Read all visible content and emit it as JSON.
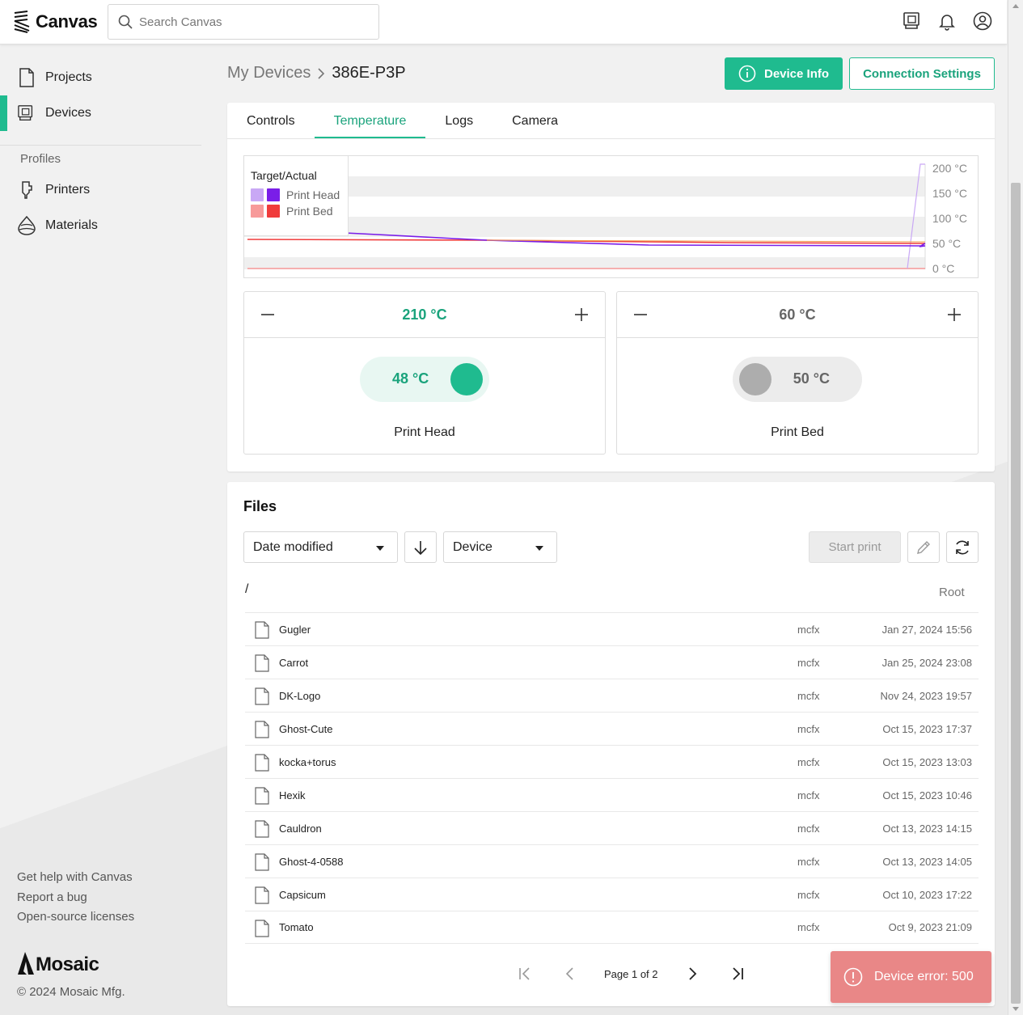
{
  "app": {
    "name": "Canvas",
    "search_placeholder": "Search Canvas"
  },
  "topbar_icons": [
    "devices-icon",
    "bell-icon",
    "account-icon"
  ],
  "sidebar": {
    "items": [
      {
        "label": "Projects",
        "icon": "document-icon"
      },
      {
        "label": "Devices",
        "icon": "devices-icon",
        "active": true
      }
    ],
    "profiles_heading": "Profiles",
    "profile_items": [
      {
        "label": "Printers",
        "icon": "printer-icon"
      },
      {
        "label": "Materials",
        "icon": "materials-icon"
      }
    ],
    "footer_links": [
      "Get help with Canvas",
      "Report a bug",
      "Open-source licenses"
    ],
    "brand": "Mosaic",
    "copyright": "© 2024 Mosaic Mfg."
  },
  "header": {
    "breadcrumb_parent": "My Devices",
    "breadcrumb_current": "386E-P3P",
    "device_info_label": "Device Info",
    "connection_settings_label": "Connection Settings"
  },
  "tabs": [
    {
      "label": "Controls",
      "active": false
    },
    {
      "label": "Temperature",
      "active": true
    },
    {
      "label": "Logs",
      "active": false
    },
    {
      "label": "Camera",
      "active": false
    }
  ],
  "temperature_chart": {
    "legend_title": "Target/Actual",
    "legend": [
      {
        "label": "Print Head",
        "target_color": "#c9a8f5",
        "actual_color": "#7a1ee8"
      },
      {
        "label": "Print Bed",
        "target_color": "#f79a9a",
        "actual_color": "#f03c3c"
      }
    ],
    "y_ticks": [
      "200 °C",
      "150 °C",
      "100 °C",
      "50 °C",
      "0 °C"
    ]
  },
  "heaters": {
    "head": {
      "target": "210 °C",
      "current": "48 °C",
      "name": "Print Head",
      "on": true
    },
    "bed": {
      "target": "60 °C",
      "current": "50 °C",
      "name": "Print Bed",
      "on": false
    }
  },
  "files": {
    "title": "Files",
    "sort_label": "Date modified",
    "source_label": "Device",
    "start_print_label": "Start print",
    "path": "/",
    "root_label": "Root",
    "rows": [
      {
        "name": "Gugler",
        "type": "mcfx",
        "date": "Jan 27, 2024 15:56"
      },
      {
        "name": "Carrot",
        "type": "mcfx",
        "date": "Jan 25, 2024 23:08"
      },
      {
        "name": "DK-Logo",
        "type": "mcfx",
        "date": "Nov 24, 2023 19:57"
      },
      {
        "name": "Ghost-Cute",
        "type": "mcfx",
        "date": "Oct 15, 2023 17:37"
      },
      {
        "name": "kocka+torus",
        "type": "mcfx",
        "date": "Oct 15, 2023 13:03"
      },
      {
        "name": "Hexik",
        "type": "mcfx",
        "date": "Oct 15, 2023 10:46"
      },
      {
        "name": "Cauldron",
        "type": "mcfx",
        "date": "Oct 13, 2023 14:15"
      },
      {
        "name": "Ghost-4-0588",
        "type": "mcfx",
        "date": "Oct 13, 2023 14:05"
      },
      {
        "name": "Capsicum",
        "type": "mcfx",
        "date": "Oct 10, 2023 17:22"
      },
      {
        "name": "Tomato",
        "type": "mcfx",
        "date": "Oct 9, 2023 21:09"
      }
    ],
    "pagination": "Page 1 of 2"
  },
  "toast": {
    "message": "Device error: 500"
  },
  "colors": {
    "accent": "#1fbb8f",
    "toast": "#e98787"
  }
}
